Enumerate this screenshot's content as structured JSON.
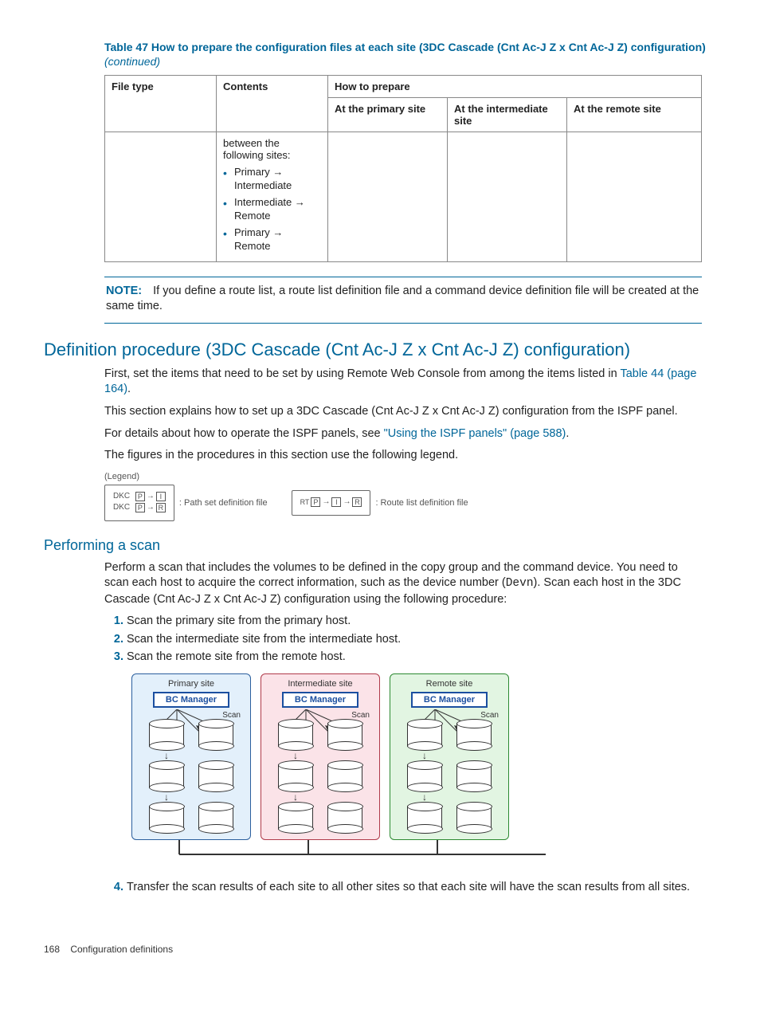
{
  "tableCaption": {
    "main": "Table 47 How to prepare the configuration files at each site (3DC Cascade (Cnt Ac-J Z x Cnt Ac-J Z) configuration)",
    "suffix": " (continued)"
  },
  "headers": {
    "fileType": "File type",
    "contents": "Contents",
    "howToPrepare": "How to prepare",
    "primary": "At the primary site",
    "intermediate": "At the intermediate site",
    "remote": "At the remote site"
  },
  "row": {
    "contentsIntro": "between the following sites:",
    "bullets": [
      "Primary → Intermediate",
      "Intermediate → Remote",
      "Primary → Remote"
    ]
  },
  "note": {
    "label": "NOTE:",
    "text": "If you define a route list, a route list definition file and a command device definition file will be created at the same time."
  },
  "section1": {
    "title": "Definition procedure (3DC Cascade (Cnt Ac-J Z x Cnt Ac-J Z) configuration)",
    "p1a": "First, set the items that need to be set by using Remote Web Console from among the items listed in ",
    "p1link": "Table 44 (page 164)",
    "p1b": ".",
    "p2": "This section explains how to set up a 3DC Cascade (Cnt Ac-J Z x Cnt Ac-J Z) configuration from the ISPF panel.",
    "p3a": "For details about how to operate the ISPF panels, see ",
    "p3link": "\"Using the ISPF panels\" (page 588)",
    "p3b": ".",
    "p4": "The figures in the procedures in this section use the following legend."
  },
  "legend": {
    "title": "(Legend)",
    "dkc": "DKC",
    "p": "P",
    "i": "I",
    "r": "R",
    "rt": "RT",
    "pathSet": ": Path set definition file",
    "routeList": ": Route list definition file"
  },
  "section2": {
    "title": "Performing a scan",
    "p1a": "Perform a scan that includes the volumes to be defined in the copy group and the command device. You need to scan each host to acquire the correct information, such as the device number (",
    "p1mono": "Devn",
    "p1b": "). Scan each host in the 3DC Cascade (Cnt Ac-J Z x Cnt Ac-J Z) configuration using the following procedure:",
    "steps": [
      "Scan the primary site from the primary host.",
      "Scan the intermediate site from the intermediate host.",
      "Scan the remote site from the remote host."
    ],
    "step4": "Transfer the scan results of each site to all other sites so that each site will have the scan results from all sites."
  },
  "diagram": {
    "primary": "Primary site",
    "intermediate": "Intermediate site",
    "remote": "Remote site",
    "bc": "BC Manager",
    "scan": "Scan"
  },
  "footer": {
    "page": "168",
    "chapter": "Configuration definitions"
  }
}
